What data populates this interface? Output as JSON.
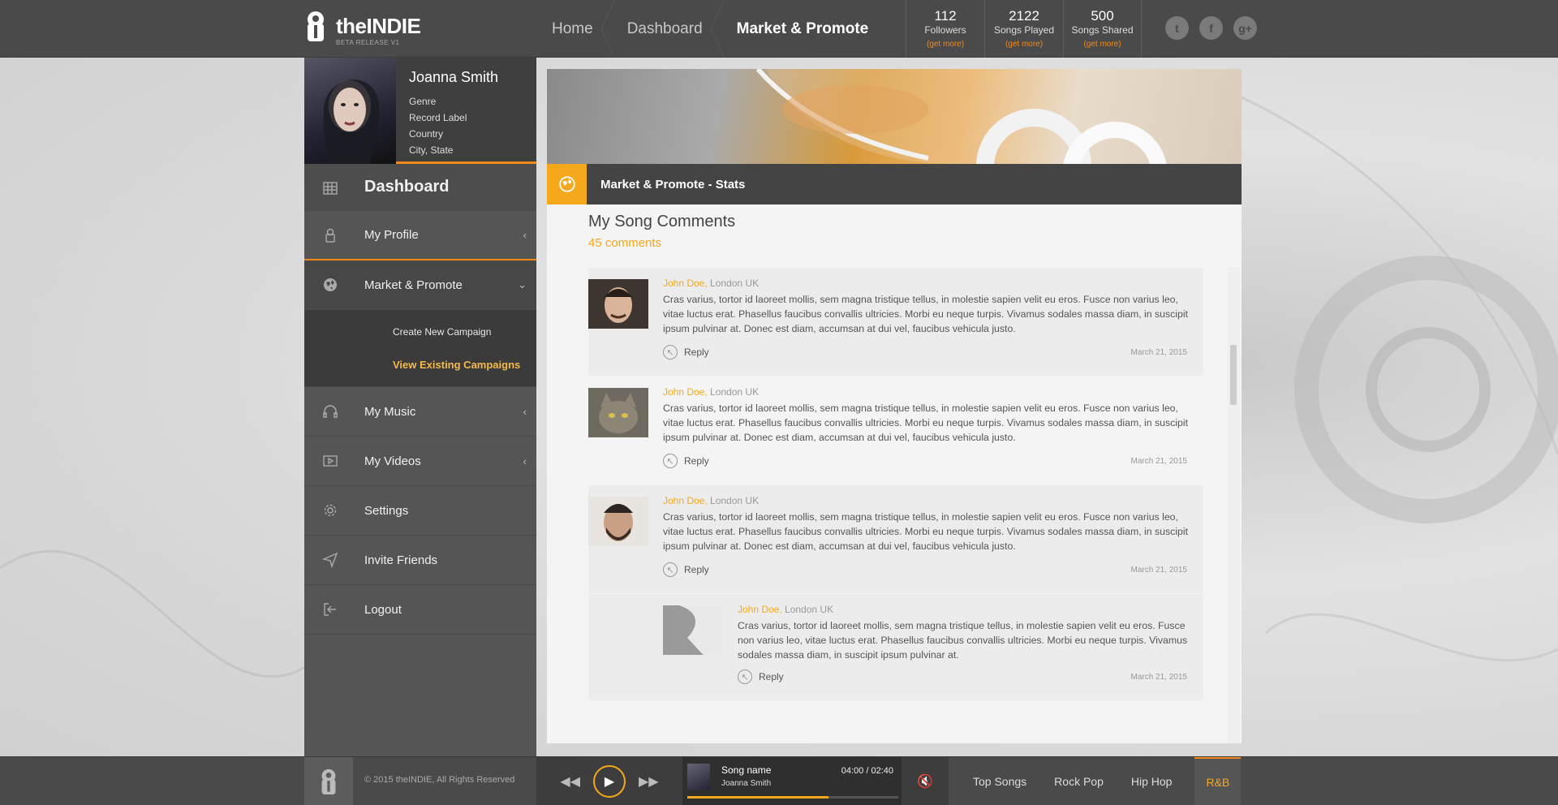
{
  "app": {
    "logo_name": "theINDIE",
    "logo_sub": "BETA RELEASE V1"
  },
  "breadcrumb": [
    {
      "label": "Home"
    },
    {
      "label": "Dashboard"
    },
    {
      "label": "Market & Promote"
    }
  ],
  "stats": [
    {
      "value": "112",
      "label": "Followers",
      "more": "(get more)"
    },
    {
      "value": "2122",
      "label": "Songs Played",
      "more": "(get more)"
    },
    {
      "value": "500",
      "label": "Songs Shared",
      "more": "(get more)"
    }
  ],
  "social": [
    {
      "icon": "twitter-icon",
      "glyph": "t"
    },
    {
      "icon": "facebook-icon",
      "glyph": "f"
    },
    {
      "icon": "google-plus-icon",
      "glyph": "g+"
    }
  ],
  "profile": {
    "name": "Joanna Smith",
    "lines": [
      "Genre",
      "Record Label",
      "Country",
      "City, State"
    ]
  },
  "sidebar": {
    "dashboard": "Dashboard",
    "my_profile": "My Profile",
    "market_promote": "Market & Promote",
    "submenu": [
      "Create New Campaign",
      "View Existing Campaigns"
    ],
    "my_music": "My Music",
    "my_videos": "My Videos",
    "settings": "Settings",
    "invite_friends": "Invite Friends",
    "logout": "Logout",
    "arrow_collapsed": "‹",
    "arrow_expanded": "›"
  },
  "section": {
    "title": "Market & Promote - Stats"
  },
  "comments": {
    "title": "My Song Comments",
    "count": "45 comments",
    "items": [
      {
        "author": "John Doe,",
        "location": " London UK",
        "text": "Cras varius, tortor id laoreet mollis, sem magna tristique tellus, in molestie sapien velit eu eros. Fusce non varius leo, vitae luctus erat. Phasellus faucibus convallis ultricies. Morbi eu neque turpis. Vivamus sodales massa diam, in suscipit ipsum pulvinar at. Donec est diam, accumsan at dui vel, faucibus vehicula justo.",
        "reply": "Reply",
        "date": "March 21, 2015"
      },
      {
        "author": "John Doe,",
        "location": " London UK",
        "text": "Cras varius, tortor id laoreet mollis, sem magna tristique tellus, in molestie sapien velit eu eros. Fusce non varius leo, vitae luctus erat. Phasellus faucibus convallis ultricies. Morbi eu neque turpis. Vivamus sodales massa diam, in suscipit ipsum pulvinar at. Donec est diam, accumsan at dui vel, faucibus vehicula justo.",
        "reply": "Reply",
        "date": "March 21, 2015"
      },
      {
        "author": "John Doe,",
        "location": " London UK",
        "text": "Cras varius, tortor id laoreet mollis, sem magna tristique tellus, in molestie sapien velit eu eros. Fusce non varius leo, vitae luctus erat. Phasellus faucibus convallis ultricies. Morbi eu neque turpis. Vivamus sodales massa diam, in suscipit ipsum pulvinar at. Donec est diam, accumsan at dui vel, faucibus vehicula justo.",
        "reply": "Reply",
        "date": "March 21, 2015"
      },
      {
        "author": "John Doe,",
        "location": " London UK",
        "text": "Cras varius, tortor id laoreet mollis, sem magna tristique tellus, in molestie sapien velit eu eros. Fusce non varius leo, vitae luctus erat. Phasellus faucibus convallis ultricies. Morbi eu neque turpis. Vivamus sodales massa diam, in suscipit ipsum pulvinar at.",
        "reply": "Reply",
        "date": "March 21, 2015"
      }
    ]
  },
  "footer": {
    "copyright": "© 2015 theINDIE, All Rights Reserved",
    "song": "Song name",
    "artist": "Joanna Smith",
    "time": "04:00 / 02:40",
    "progress": 0.67,
    "genres": [
      "Top Songs",
      "Rock Pop",
      "Hip Hop",
      "R&B"
    ]
  },
  "colors": {
    "accent": "#f5a81c",
    "accent_dark": "#f08a1c",
    "bar": "#4a4a4a"
  }
}
